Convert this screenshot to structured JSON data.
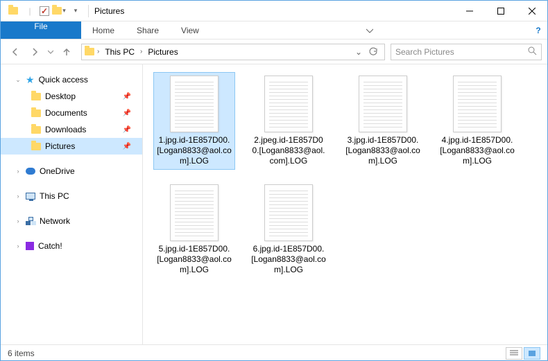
{
  "window": {
    "title": "Pictures",
    "qat_check": "✓"
  },
  "ribbon": {
    "tabs": [
      "File",
      "Home",
      "Share",
      "View"
    ]
  },
  "nav": {
    "crumbs": [
      "This PC",
      "Pictures"
    ],
    "search_placeholder": "Search Pictures"
  },
  "sidebar": {
    "quick_access": "Quick access",
    "items": [
      {
        "label": "Desktop",
        "pinned": true
      },
      {
        "label": "Documents",
        "pinned": true
      },
      {
        "label": "Downloads",
        "pinned": true
      },
      {
        "label": "Pictures",
        "pinned": true,
        "selected": true
      }
    ],
    "roots": [
      {
        "label": "OneDrive",
        "icon": "cloud"
      },
      {
        "label": "This PC",
        "icon": "monitor"
      },
      {
        "label": "Network",
        "icon": "network"
      },
      {
        "label": "Catch!",
        "icon": "square"
      }
    ]
  },
  "files": [
    {
      "name": "1.jpg.id-1E857D00.[Logan8833@aol.com].LOG",
      "selected": true
    },
    {
      "name": "2.jpeg.id-1E857D00.[Logan8833@aol.com].LOG"
    },
    {
      "name": "3.jpg.id-1E857D00.[Logan8833@aol.com].LOG"
    },
    {
      "name": "4.jpg.id-1E857D00.[Logan8833@aol.com].LOG"
    },
    {
      "name": "5.jpg.id-1E857D00.[Logan8833@aol.com].LOG"
    },
    {
      "name": "6.jpg.id-1E857D00.[Logan8833@aol.com].LOG"
    }
  ],
  "status": {
    "count_label": "6 items"
  }
}
